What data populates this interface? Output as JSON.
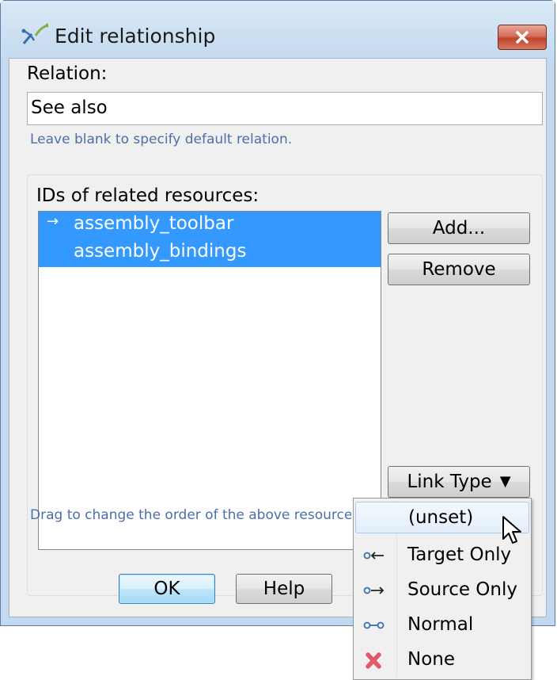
{
  "window": {
    "title": "Edit relationship"
  },
  "relation": {
    "label": "Relation:",
    "value": "See also",
    "hint": "Leave blank to specify default relation."
  },
  "resources": {
    "label": "IDs of related resources:",
    "items": [
      {
        "arrow": "→",
        "label": "assembly_toolbar"
      },
      {
        "arrow": "",
        "label": "assembly_bindings"
      }
    ],
    "hint": "Drag to change the order of the above resource"
  },
  "buttons": {
    "add": "Add...",
    "remove": "Remove",
    "link_type": "Link Type",
    "ok": "OK",
    "help": "Help"
  },
  "link_type_menu": {
    "items": [
      {
        "label": "(unset)",
        "icon": "none",
        "highlighted": true
      },
      {
        "label": "Target Only",
        "icon": "target-only-icon"
      },
      {
        "label": "Source Only",
        "icon": "source-only-icon"
      },
      {
        "label": "Normal",
        "icon": "normal-link-icon"
      },
      {
        "label": "None",
        "icon": "red-x-icon"
      }
    ]
  },
  "colors": {
    "selection": "#3399ff",
    "hint_text": "#4d6fa8",
    "close_button": "#c0442c"
  }
}
